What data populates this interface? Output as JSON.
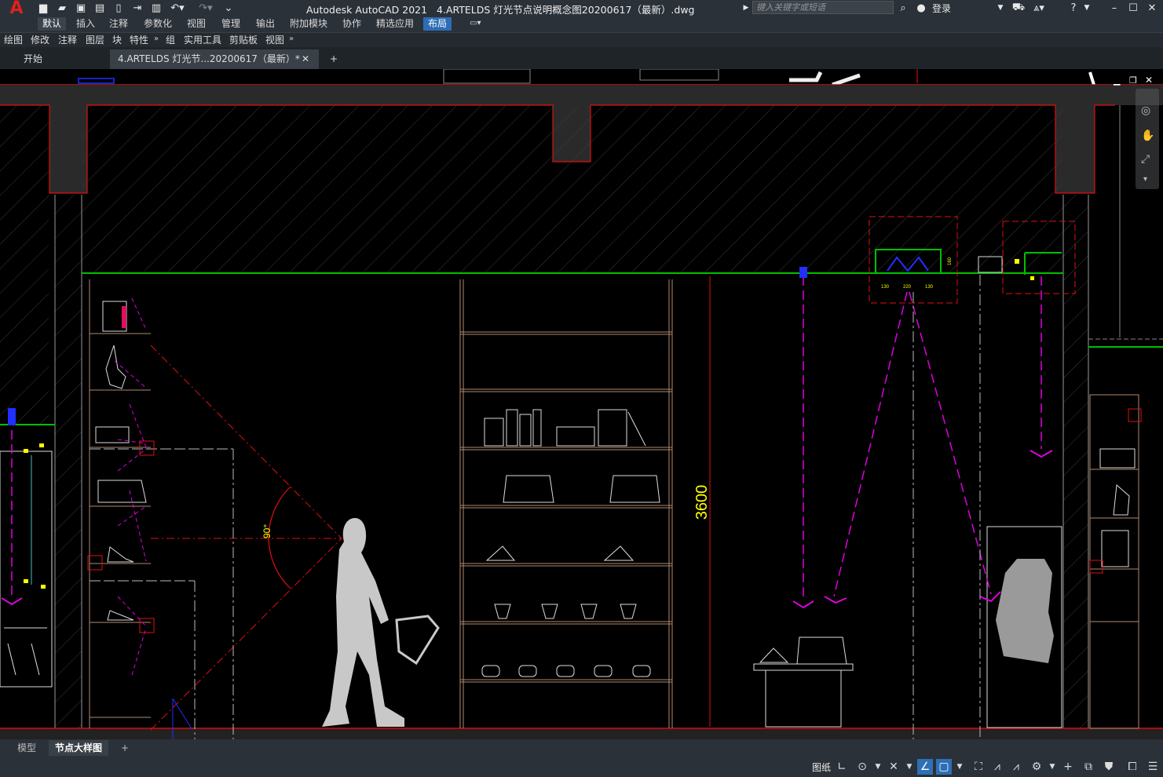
{
  "app": {
    "name": "Autodesk AutoCAD 2021",
    "document": "4.ARTELDS 灯光节点说明概念图20200617（最新）.dwg",
    "search_placeholder": "键入关键字或短语",
    "login": "登录",
    "logo": "A"
  },
  "ribbon_tabs": [
    "默认",
    "插入",
    "注释",
    "参数化",
    "视图",
    "管理",
    "输出",
    "附加模块",
    "协作",
    "精选应用",
    "布局"
  ],
  "panels": [
    "绘图",
    "修改",
    "注释",
    "图层",
    "块",
    "特性",
    "组",
    "实用工具",
    "剪贴板",
    "视图"
  ],
  "doc_tabs": {
    "start": "开始",
    "current": "4.ARTELDS 灯光节...20200617（最新）*",
    "close": "✕",
    "add": "+"
  },
  "layout_tabs": [
    "模型",
    "节点大样图",
    "+"
  ],
  "status": {
    "paper_label": "图纸"
  },
  "drawing": {
    "dimension_height": "3600",
    "angle_label": "90°",
    "detail_dims": [
      "130",
      "220",
      "130"
    ],
    "detail_height": "160"
  },
  "colors": {
    "accent": "#2d6db5",
    "cad_red": "#e01010",
    "cad_magenta": "#e000e0",
    "cad_yellow": "#ffff00",
    "cad_green": "#00c000",
    "cad_furniture": "#b08a6e"
  }
}
